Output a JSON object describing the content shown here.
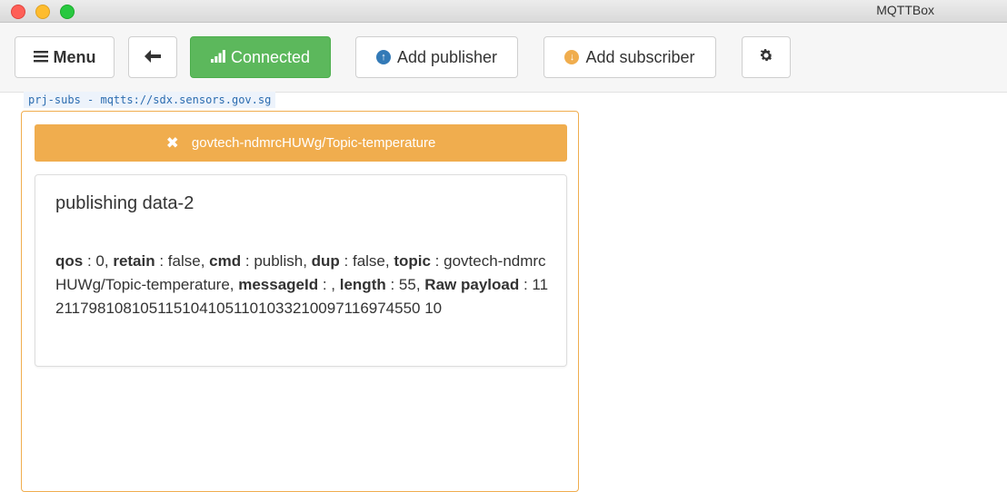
{
  "window": {
    "title": "MQTTBox"
  },
  "toolbar": {
    "menu_label": "Menu",
    "connected_label": "Connected",
    "add_publisher_label": "Add publisher",
    "add_subscriber_label": "Add subscriber",
    "accent_connected": "#5cb85c"
  },
  "connection": {
    "label": "prj-subs - mqtts://sdx.sensors.gov.sg"
  },
  "subscriber": {
    "topic": "govtech-ndmrcHUWg/Topic-temperature",
    "accent": "#f0ad4e",
    "message": {
      "payload_text": "publishing data-2",
      "fields": [
        {
          "key": "qos",
          "value": "0"
        },
        {
          "key": "retain",
          "value": "false"
        },
        {
          "key": "cmd",
          "value": "publish"
        },
        {
          "key": "dup",
          "value": "false"
        },
        {
          "key": "topic",
          "value": "govtech-ndmrcHUWg/Topic-temperature"
        },
        {
          "key": "messageId",
          "value": ""
        },
        {
          "key": "length",
          "value": "55"
        },
        {
          "key": "Raw payload",
          "value": "112117981081051151041051101033210097116974550 10"
        }
      ]
    }
  }
}
